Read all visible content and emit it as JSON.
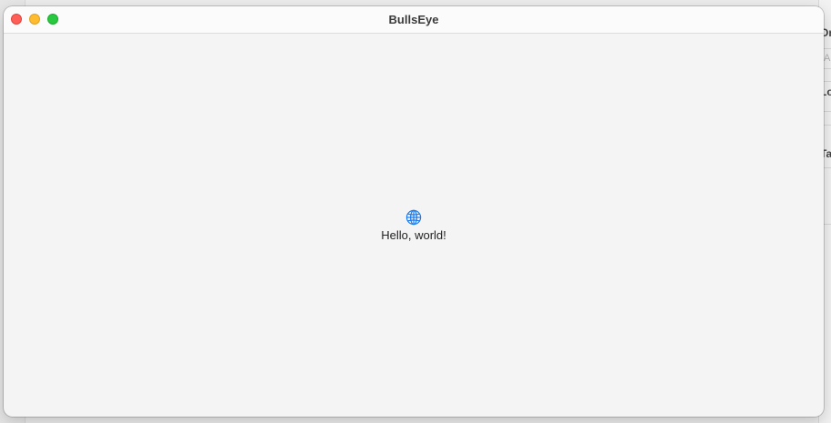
{
  "window": {
    "title": "BullsEye"
  },
  "content": {
    "icon": "globe-icon",
    "greeting": "Hello, world!"
  },
  "background_app": {
    "label_1": "Or",
    "label_2": "Lo",
    "label_3": "Ta",
    "field_placeholder": "A"
  },
  "colors": {
    "accent": "#1a7cf2",
    "close": "#ff5f57",
    "minimize": "#febc2e",
    "maximize": "#28c840"
  }
}
